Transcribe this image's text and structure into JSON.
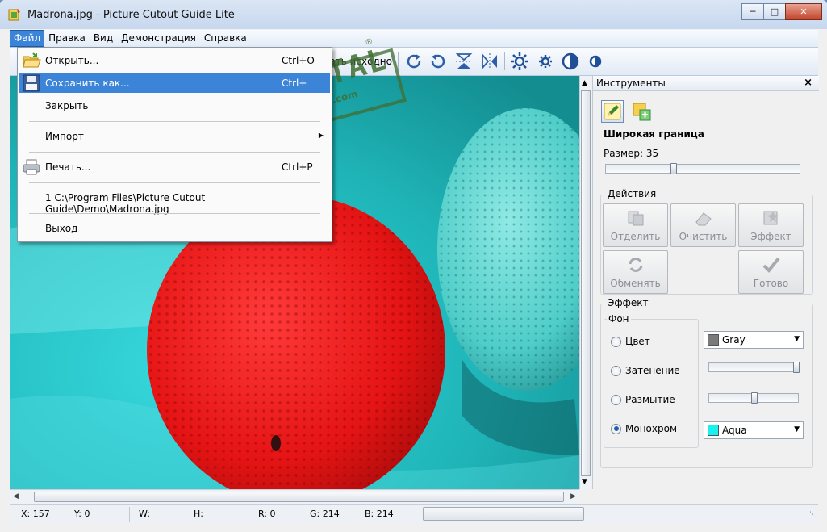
{
  "window": {
    "title": "Madrona.jpg - Picture Cutout Guide Lite"
  },
  "menubar": {
    "items": [
      "Файл",
      "Правка",
      "Вид",
      "Демонстрация",
      "Справка"
    ]
  },
  "toolbar": {
    "partial_text": "зать исходно"
  },
  "file_menu": {
    "items": [
      {
        "label": "Открыть...",
        "shortcut": "Ctrl+O",
        "icon": "folder-icon"
      },
      {
        "label": "Сохранить как...",
        "shortcut": "Ctrl+",
        "icon": "floppy-icon"
      },
      {
        "label": "Закрыть",
        "shortcut": ""
      },
      {
        "label": "Импорт",
        "shortcut": ""
      },
      {
        "label": "Печать...",
        "shortcut": "Ctrl+P",
        "icon": "printer-icon"
      },
      {
        "label": "1 C:\\Program Files\\Picture Cutout Guide\\Demo\\Madrona.jpg",
        "shortcut": ""
      },
      {
        "label": "Выход",
        "shortcut": ""
      }
    ]
  },
  "watermark": {
    "text": "SOFTPORTAL",
    "sub": "www.softportal.com"
  },
  "tools_panel": {
    "title": "Инструменты",
    "section_title": "Широкая граница",
    "size_label": "Размер: 35",
    "size_value": 35,
    "actions": {
      "label": "Действия",
      "buttons": [
        "Отделить",
        "Очистить",
        "Эффект",
        "Обменять",
        "Готово"
      ]
    },
    "effect": {
      "label": "Эффект",
      "background_label": "Фон",
      "options": [
        "Цвет",
        "Затенение",
        "Размытие",
        "Монохром"
      ],
      "selected": "Монохром",
      "color_combo": "Gray",
      "color_combo_swatch": "#7a7a7a",
      "mono_combo": "Aqua",
      "mono_combo_swatch": "#19f0f0"
    }
  },
  "statusbar": {
    "x": "X: 157",
    "y": "Y: 0",
    "w": "W:",
    "h": "H:",
    "r": "R: 0",
    "g": "G: 214",
    "b": "B: 214"
  }
}
